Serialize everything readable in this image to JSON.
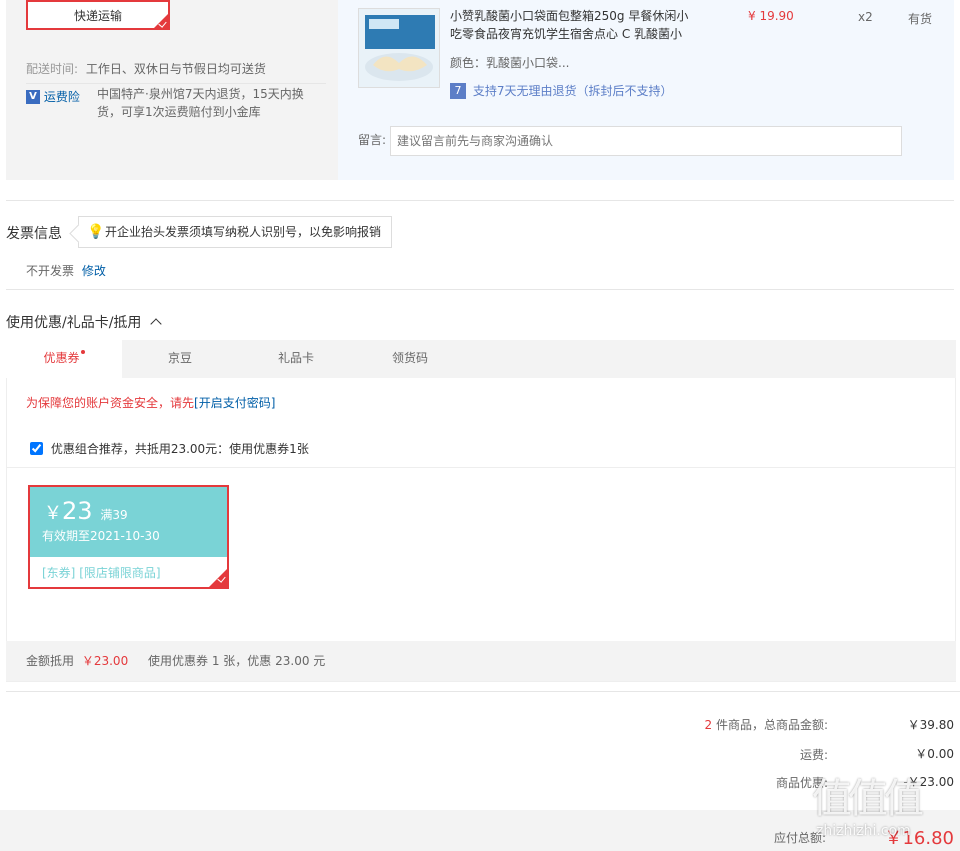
{
  "shipping": {
    "method": "快递运输",
    "delivery_label": "配送时间:",
    "delivery_value": "工作日、双休日与节假日均可送货",
    "insurance_icon": "V",
    "insurance_label": "运费险",
    "insurance_desc": "中国特产·泉州馆7天内退货，15天内换货，可享1次运费赔付到小金库"
  },
  "product": {
    "title": "小赞乳酸菌小口袋面包整箱250g 早餐休闲小吃零食品夜宵充饥学生宿舍点心 C 乳酸菌小",
    "price": "¥ 19.90",
    "qty": "x2",
    "stock": "有货",
    "color": "颜色：乳酸菌小口袋...",
    "return_icon": "7",
    "return_policy": "支持7天无理由退货（拆封后不支持）",
    "message_label": "留言:",
    "message_placeholder": "建议留言前先与商家沟通确认"
  },
  "invoice": {
    "title": "发票信息",
    "tip": "开企业抬头发票须填写纳税人识别号，以免影响报销",
    "status": "不开发票",
    "edit": "修改"
  },
  "discount": {
    "title": "使用优惠/礼品卡/抵用",
    "tabs": [
      "优惠券",
      "京豆",
      "礼品卡",
      "领货码"
    ],
    "security_prefix": "为保障您的账户资金安全，请先",
    "security_link": "[开启支付密码]",
    "combo_label": "优惠组合推荐，共抵用23.00元：使用优惠券1张",
    "coupon": {
      "currency": "￥",
      "amount": "23",
      "threshold": "满39",
      "expiry": "有效期至2021-10-30",
      "tag1": "[东券]",
      "tag2": "[限店铺限商品]"
    },
    "summary_label": "金额抵用",
    "summary_amount": "￥23.00",
    "summary_desc": "使用优惠券 1 张，优惠 23.00 元"
  },
  "totals": {
    "count": "2",
    "count_label": "件商品，总商品金额:",
    "count_value": "￥39.80",
    "shipping_label": "运费:",
    "shipping_value": "￥0.00",
    "discount_label": "商品优惠:",
    "discount_value": "-￥23.00",
    "payable_label": "应付总额:",
    "payable_value": "￥16.80"
  },
  "watermark": "值值值",
  "watermark_site": "zhizhizhi.com",
  "colors": {
    "accent": "#e4393c",
    "link": "#005ea7",
    "coupon": "#7ad3d6"
  }
}
